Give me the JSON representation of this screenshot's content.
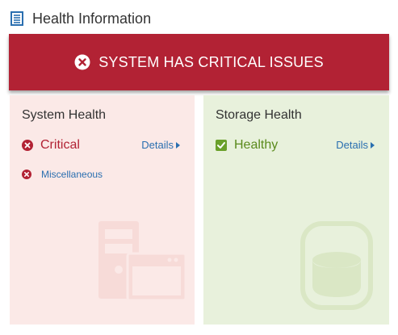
{
  "header": {
    "title": "Health Information",
    "icon": "document-list-icon"
  },
  "banner": {
    "text": "SYSTEM HAS CRITICAL ISSUES",
    "icon": "error-circle-icon",
    "color": "#b22234"
  },
  "system_health": {
    "title": "System Health",
    "status": "Critical",
    "status_icon": "error-circle-icon",
    "status_color": "#b22234",
    "details_label": "Details",
    "issues": [
      {
        "label": "Miscellaneous",
        "icon": "error-circle-icon"
      }
    ],
    "background": "#fbe9e7",
    "watermark_icon": "server-window-icon"
  },
  "storage_health": {
    "title": "Storage Health",
    "status": "Healthy",
    "status_icon": "checkbox-check-icon",
    "status_color": "#5a8a1c",
    "details_label": "Details",
    "background": "#e8f1dc",
    "watermark_icon": "storage-drum-icon"
  }
}
